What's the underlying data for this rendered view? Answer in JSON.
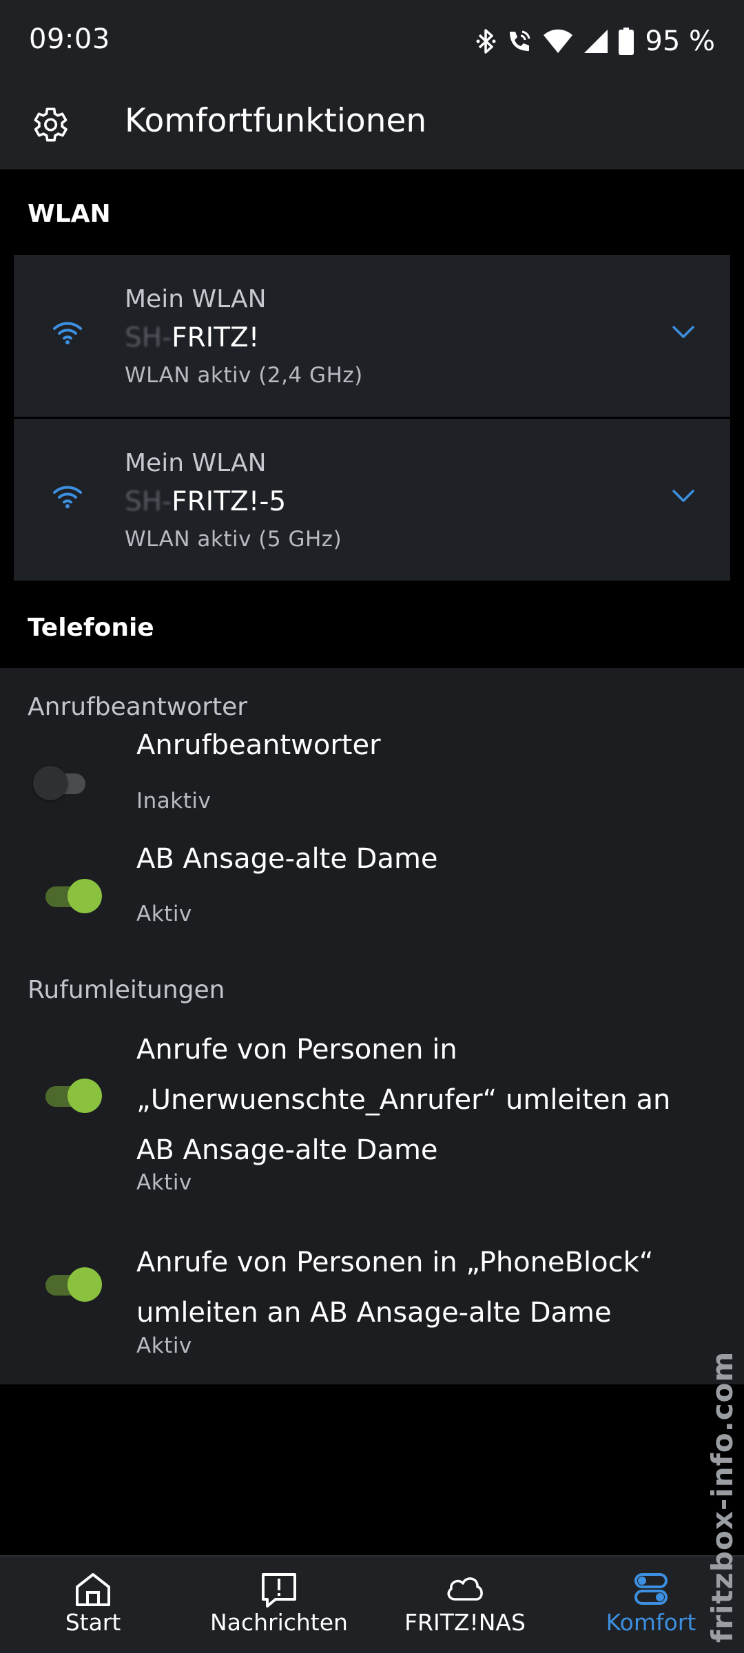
{
  "status_bar": {
    "time": "09:03",
    "battery": "95 %",
    "icons": [
      "bluetooth-icon",
      "wifi-calling-icon",
      "wifi-signal-icon",
      "cell-signal-icon",
      "battery-icon"
    ]
  },
  "app_bar": {
    "icon": "gear-icon",
    "title": "Komfortfunktionen"
  },
  "wlan_section": {
    "title": "WLAN",
    "networks": [
      {
        "label": "Mein WLAN",
        "ssid_hidden": "SH-",
        "ssid": "FRITZ!",
        "status": "WLAN aktiv (2,4 GHz)"
      },
      {
        "label": "Mein WLAN",
        "ssid_hidden": "SH-",
        "ssid": "FRITZ!-5",
        "status": "WLAN aktiv (5 GHz)"
      }
    ]
  },
  "telefonie_section": {
    "title": "Telefonie",
    "anrufbeantworter_header": "Anrufbeantworter",
    "anrufbeantworter": [
      {
        "title": "Anrufbeantworter",
        "status": "Inaktiv",
        "enabled": false
      },
      {
        "title": "AB Ansage-alte Dame",
        "status": "Aktiv",
        "enabled": true
      }
    ],
    "rufumleitungen_header": "Rufumleitungen",
    "rufumleitungen": [
      {
        "title": "Anrufe von Personen in „Unerwuenschte_Anrufer“ umleiten an AB Ansage-alte Dame",
        "status": "Aktiv",
        "enabled": true
      },
      {
        "title": "Anrufe von Personen in „PhoneBlock“ umleiten an AB Ansage-alte Dame",
        "status": "Aktiv",
        "enabled": true
      }
    ]
  },
  "bottom_nav": {
    "items": [
      {
        "label": "Start",
        "icon": "home-icon"
      },
      {
        "label": "Nachrichten",
        "icon": "message-alert-icon"
      },
      {
        "label": "FRITZ!NAS",
        "icon": "cloud-icon"
      },
      {
        "label": "Komfort",
        "icon": "toggles-icon"
      }
    ],
    "active_index": 3
  },
  "watermark": "fritzbox-info.com",
  "colors": {
    "accent": "#3d8fe0",
    "toggle_on": "#8ac240",
    "background": "#000000",
    "surface": "#1b1d21"
  }
}
